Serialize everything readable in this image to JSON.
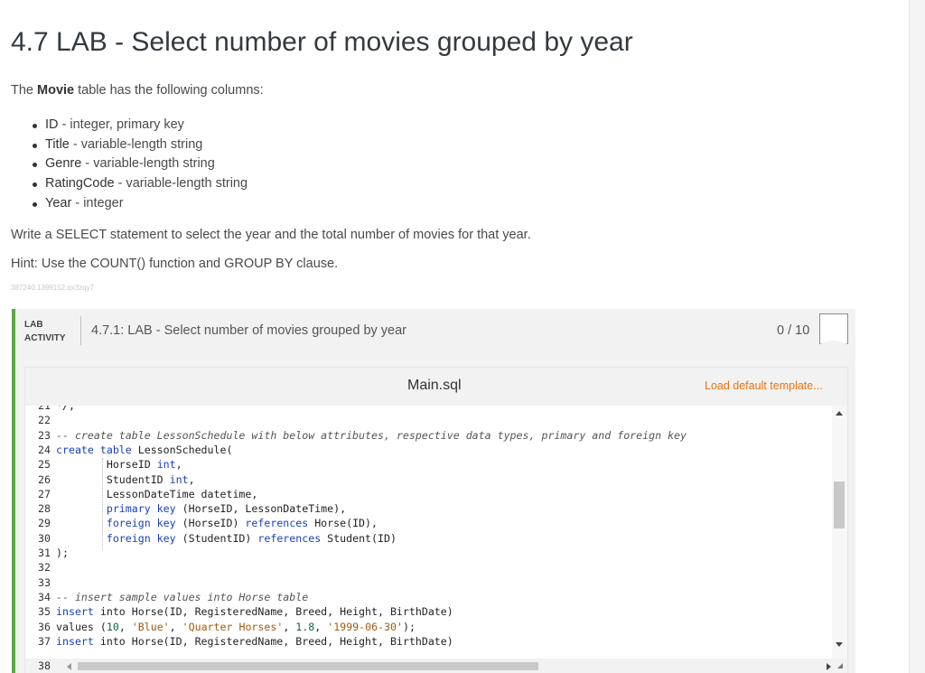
{
  "heading": "4.7 LAB - Select number of movies grouped by year",
  "intro": {
    "pre": "The ",
    "table": "Movie",
    "post": " table has the following columns:"
  },
  "columns": [
    {
      "name": "ID",
      "desc": " - integer, primary key"
    },
    {
      "name": "Title",
      "desc": " - variable-length string"
    },
    {
      "name": "Genre",
      "desc": " - variable-length string"
    },
    {
      "name": "RatingCode",
      "desc": " - variable-length string"
    },
    {
      "name": "Year",
      "desc": " - integer"
    }
  ],
  "instruction": "Write a SELECT statement to select the year and the total number of movies for that year.",
  "hint": "Hint: Use the COUNT() function and GROUP BY clause.",
  "tiny_id": "387240.1399152.qx3zqy7",
  "lab": {
    "tag_line1": "LAB",
    "tag_line2": "ACTIVITY",
    "name": "4.7.1: LAB - Select number of movies grouped by year",
    "score": "0 / 10"
  },
  "editor": {
    "filename": "Main.sql",
    "load_template": "Load default template...",
    "last_line_number": "38",
    "lines": [
      {
        "n": "21",
        "segs": [
          {
            "c": "txt",
            "t": "*/;"
          }
        ]
      },
      {
        "n": "22",
        "segs": []
      },
      {
        "n": "23",
        "segs": [
          {
            "c": "cm",
            "t": "-- create table LessonSchedule with below attributes, respective data types, primary and foreign key"
          }
        ]
      },
      {
        "n": "24",
        "segs": [
          {
            "c": "kw",
            "t": "create table"
          },
          {
            "c": "txt",
            "t": " LessonSchedule("
          }
        ]
      },
      {
        "n": "25",
        "segs": [
          {
            "c": "txt",
            "t": "        HorseID "
          },
          {
            "c": "kw",
            "t": "int"
          },
          {
            "c": "txt",
            "t": ","
          }
        ]
      },
      {
        "n": "26",
        "segs": [
          {
            "c": "txt",
            "t": "        StudentID "
          },
          {
            "c": "kw",
            "t": "int"
          },
          {
            "c": "txt",
            "t": ","
          }
        ]
      },
      {
        "n": "27",
        "segs": [
          {
            "c": "txt",
            "t": "        LessonDateTime datetime,"
          }
        ]
      },
      {
        "n": "28",
        "segs": [
          {
            "c": "txt",
            "t": "        "
          },
          {
            "c": "kw",
            "t": "primary key"
          },
          {
            "c": "txt",
            "t": " (HorseID, LessonDateTime),"
          }
        ]
      },
      {
        "n": "29",
        "segs": [
          {
            "c": "txt",
            "t": "        "
          },
          {
            "c": "kw",
            "t": "foreign key"
          },
          {
            "c": "txt",
            "t": " (HorseID) "
          },
          {
            "c": "kw",
            "t": "references"
          },
          {
            "c": "txt",
            "t": " Horse(ID),"
          }
        ]
      },
      {
        "n": "30",
        "segs": [
          {
            "c": "txt",
            "t": "        "
          },
          {
            "c": "kw",
            "t": "foreign key"
          },
          {
            "c": "txt",
            "t": " (StudentID) "
          },
          {
            "c": "kw",
            "t": "references"
          },
          {
            "c": "txt",
            "t": " Student(ID)"
          }
        ]
      },
      {
        "n": "31",
        "segs": [
          {
            "c": "txt",
            "t": ");"
          }
        ]
      },
      {
        "n": "32",
        "segs": []
      },
      {
        "n": "33",
        "segs": []
      },
      {
        "n": "34",
        "segs": [
          {
            "c": "cm",
            "t": "-- insert sample values into Horse table"
          }
        ]
      },
      {
        "n": "35",
        "segs": [
          {
            "c": "kw",
            "t": "insert"
          },
          {
            "c": "txt",
            "t": " into Horse(ID, RegisteredName, Breed, Height, BirthDate)"
          }
        ]
      },
      {
        "n": "36",
        "segs": [
          {
            "c": "txt",
            "t": "values ("
          },
          {
            "c": "num",
            "t": "10"
          },
          {
            "c": "txt",
            "t": ", "
          },
          {
            "c": "str",
            "t": "'Blue'"
          },
          {
            "c": "txt",
            "t": ", "
          },
          {
            "c": "str",
            "t": "'Quarter Horses'"
          },
          {
            "c": "txt",
            "t": ", "
          },
          {
            "c": "num",
            "t": "1.8"
          },
          {
            "c": "txt",
            "t": ", "
          },
          {
            "c": "str",
            "t": "'1999-06-30'"
          },
          {
            "c": "txt",
            "t": ");"
          }
        ]
      },
      {
        "n": "37",
        "segs": [
          {
            "c": "kw",
            "t": "insert"
          },
          {
            "c": "txt",
            "t": " into Horse(ID, RegisteredName, Breed, Height, BirthDate)"
          }
        ]
      }
    ]
  },
  "colors": {
    "accent_green": "#5aaa45",
    "link_orange": "#e8730c",
    "keyword_blue": "#1a3fb3"
  }
}
